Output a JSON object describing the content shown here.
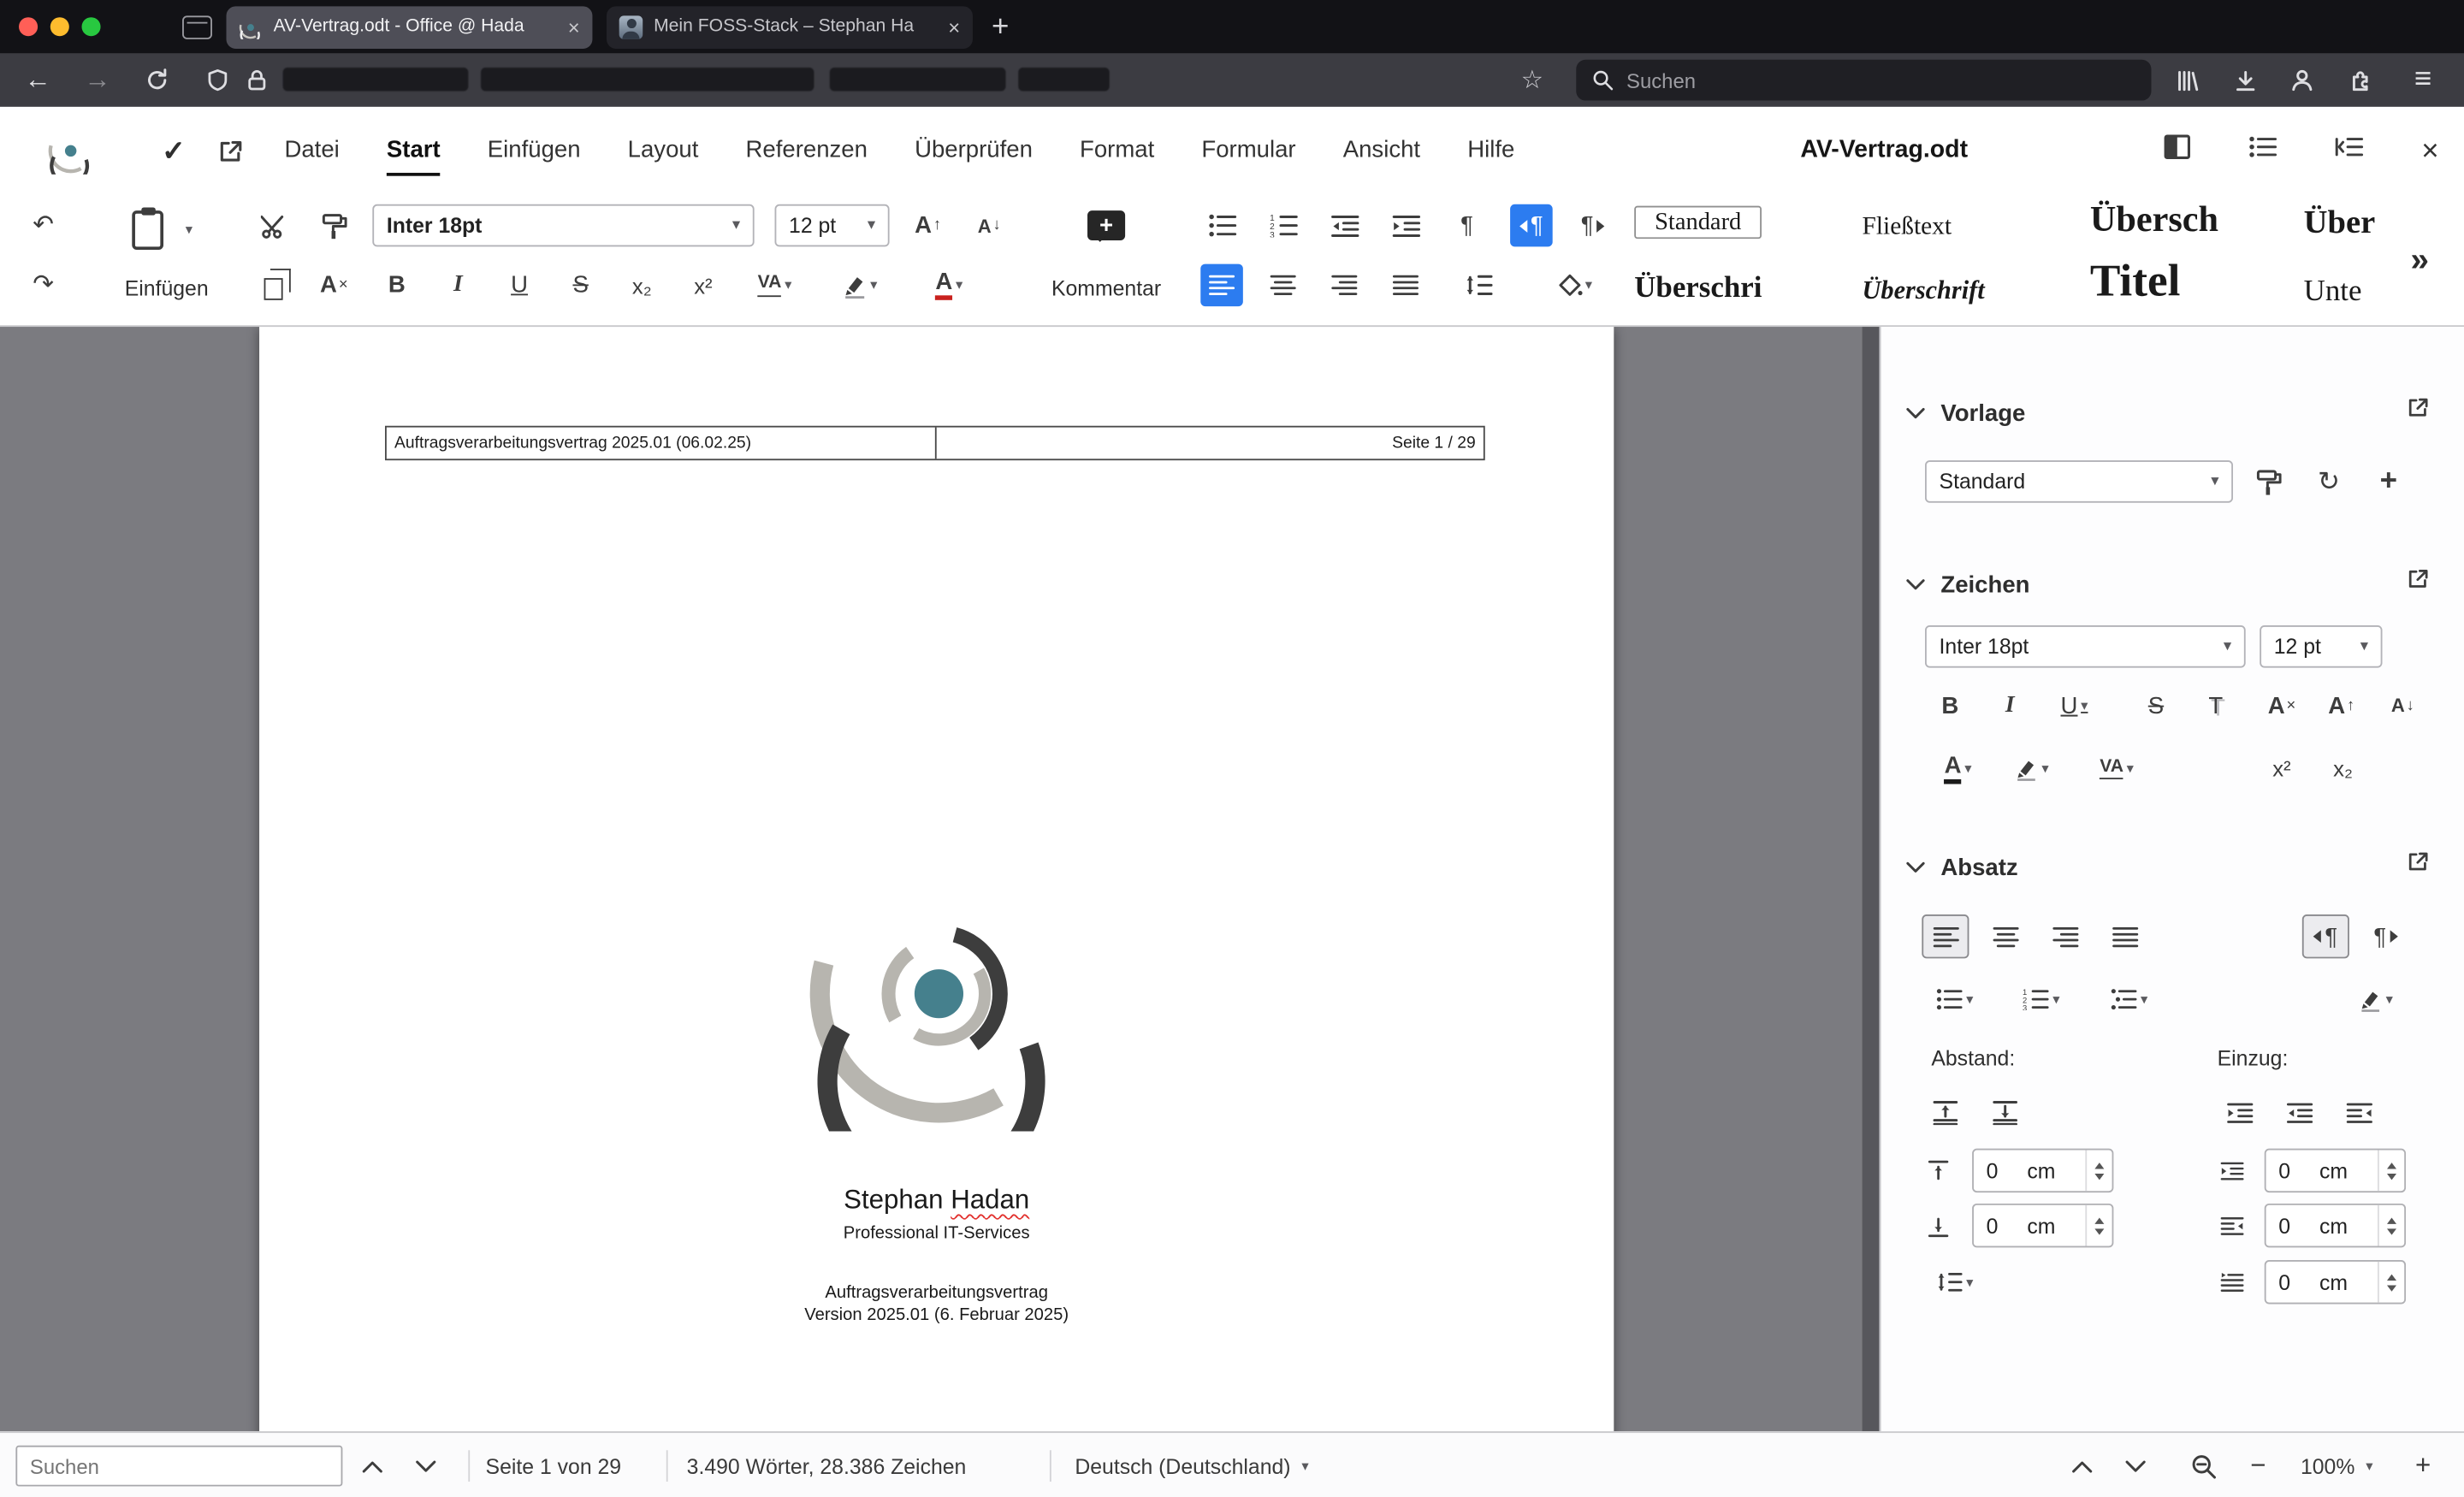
{
  "colors": {
    "accent_blue": "#2c7cf0",
    "traffic_red": "#ff5f57",
    "traffic_yellow": "#febc2e",
    "traffic_green": "#28c840",
    "misspell_red": "#e2312e",
    "logo_dark": "#3d3d3d",
    "logo_light": "#b7b5af",
    "logo_teal": "#45808d"
  },
  "icons": {
    "caret": "▾",
    "undo": "↶",
    "redo": "↷",
    "pilcrow": "¶",
    "close": "×",
    "plus": "+",
    "minus": "−",
    "star": "☆",
    "back": "←",
    "forward": "→",
    "menu": "≡",
    "refresh": "↻",
    "gallery_more": "»",
    "check": "✓",
    "arrow_up": "↑",
    "arrow_down": "↓"
  },
  "browser": {
    "tabs": [
      {
        "title": "AV-Vertrag.odt - Office @ Hada",
        "active": true
      },
      {
        "title": "Mein FOSS-Stack – Stephan Ha",
        "active": false
      }
    ],
    "search_placeholder": "Suchen"
  },
  "app": {
    "menu": [
      "Datei",
      "Start",
      "Einfügen",
      "Layout",
      "Referenzen",
      "Überprüfen",
      "Format",
      "Formular",
      "Ansicht",
      "Hilfe"
    ],
    "doc_title": "AV-Vertrag.odt"
  },
  "toolbar": {
    "paste_label": "Einfügen",
    "comment_label": "Kommentar",
    "font_name": "Inter 18pt",
    "font_size": "12 pt",
    "chars": {
      "bold": "B",
      "italic": "I",
      "underline": "U",
      "strikethrough": "S",
      "shadow": "T",
      "letter_a": "A",
      "subscript": "x₂",
      "superscript": "x²",
      "spacing": "VA"
    },
    "styles": {
      "standard": "Standard",
      "fliesstext": "Fließtext",
      "uebersch": "Übersch",
      "ueber": "Über",
      "ueberschri": "Überschri",
      "ueberschrift": "Überschrift",
      "titel": "Titel",
      "unte": "Unte"
    }
  },
  "document": {
    "header": {
      "left": "Auftragsverarbeitungsvertrag 2025.01 (06.02.25)",
      "right": "Seite 1 / 29"
    },
    "title_first": "Stephan",
    "title_last": "Hadan",
    "subtitle": "Professional IT-Services",
    "line1": "Auftragsverarbeitungsvertrag",
    "line2": "Version 2025.01 (6. Februar 2025)"
  },
  "sidebar": {
    "vorlage": {
      "title": "Vorlage",
      "selected_style": "Standard"
    },
    "zeichen": {
      "title": "Zeichen",
      "font_name": "Inter 18pt",
      "font_size": "12 pt"
    },
    "absatz": {
      "title": "Absatz",
      "abstand_label": "Abstand:",
      "einzug_label": "Einzug:",
      "unit": "cm",
      "abstand_values": [
        "0",
        "0"
      ],
      "einzug_values": [
        "0",
        "0",
        "0"
      ]
    }
  },
  "statusbar": {
    "search_placeholder": "Suchen",
    "page_info": "Seite 1 von 29",
    "word_count": "3.490 Wörter, 28.386 Zeichen",
    "language": "Deutsch (Deutschland)",
    "zoom_level": "100%"
  }
}
